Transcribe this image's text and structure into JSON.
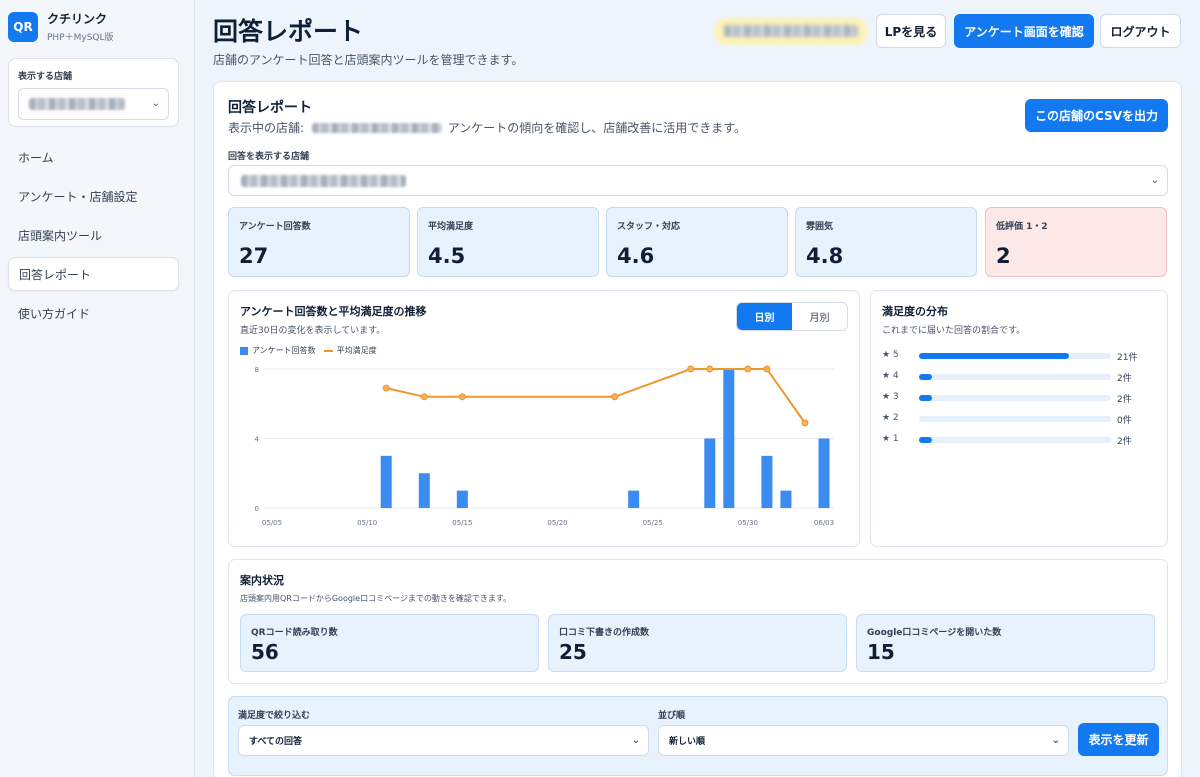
{
  "sidebar": {
    "logo": "QR",
    "app_name": "クチリンク",
    "app_sub": "PHP＋MySQL版",
    "store_label": "表示する店舗",
    "nav": [
      "ホーム",
      "アンケート・店舗設定",
      "店頭案内ツール",
      "回答レポート",
      "使い方ガイド"
    ]
  },
  "header": {
    "title": "回答レポート",
    "description": "店舗のアンケート回答と店頭案内ツールを管理できます。",
    "btn_lp": "LPを見る",
    "btn_survey": "アンケート画面を確認",
    "btn_logout": "ログアウト"
  },
  "report": {
    "title": "回答レポート",
    "subtitle_prefix": "表示中の店舗:",
    "subtitle_suffix": "アンケートの傾向を確認し、店舗改善に活用できます。",
    "csv_button": "この店舗のCSVを出力",
    "store_select_label": "回答を表示する店舗"
  },
  "stats": [
    {
      "label": "アンケート回答数",
      "value": "27"
    },
    {
      "label": "平均満足度",
      "value": "4.5"
    },
    {
      "label": "スタッフ・対応",
      "value": "4.6"
    },
    {
      "label": "雰囲気",
      "value": "4.8"
    },
    {
      "label": "低評価 1・2",
      "value": "2"
    }
  ],
  "trend": {
    "title": "アンケート回答数と平均満足度の推移",
    "sub": "直近30日の変化を表示しています。",
    "toggle_day": "日別",
    "toggle_month": "月別",
    "legend_bar": "アンケート回答数",
    "legend_line": "平均満足度"
  },
  "chart_data": {
    "type": "bar",
    "x": [
      "05/05",
      "05/06",
      "05/07",
      "05/08",
      "05/09",
      "05/10",
      "05/11",
      "05/12",
      "05/13",
      "05/14",
      "05/15",
      "05/16",
      "05/17",
      "05/18",
      "05/19",
      "05/20",
      "05/21",
      "05/22",
      "05/23",
      "05/24",
      "05/25",
      "05/26",
      "05/27",
      "05/28",
      "05/29",
      "05/30",
      "05/31",
      "06/01",
      "06/02",
      "06/03"
    ],
    "tick_labels": [
      "05/05",
      "05/10",
      "05/15",
      "05/20",
      "05/25",
      "05/30",
      "06/03"
    ],
    "ylim": [
      0,
      8
    ],
    "yticks": [
      0,
      4,
      8
    ],
    "grid": true,
    "series": [
      {
        "name": "アンケート回答数",
        "type": "bar",
        "color": "#3b8cf0",
        "values": [
          0,
          0,
          0,
          0,
          0,
          0,
          3,
          0,
          2,
          0,
          1,
          0,
          0,
          0,
          0,
          0,
          0,
          0,
          0,
          1,
          0,
          0,
          0,
          4,
          8,
          0,
          3,
          1,
          0,
          4
        ]
      },
      {
        "name": "平均満足度",
        "type": "line",
        "color": "#f0962c",
        "points": [
          [
            6,
            6.9
          ],
          [
            8,
            6.4
          ],
          [
            10,
            6.4
          ],
          [
            18,
            6.4
          ],
          [
            22,
            8
          ],
          [
            23,
            8
          ],
          [
            25,
            8
          ],
          [
            26,
            8
          ],
          [
            28,
            4.9
          ]
        ]
      }
    ]
  },
  "distribution": {
    "title": "満足度の分布",
    "sub": "これまでに届いた回答の割合です。",
    "rows": [
      {
        "star": "★ 5",
        "count": "21件",
        "ratio": 0.78
      },
      {
        "star": "★ 4",
        "count": "2件",
        "ratio": 0.07
      },
      {
        "star": "★ 3",
        "count": "2件",
        "ratio": 0.07
      },
      {
        "star": "★ 2",
        "count": "0件",
        "ratio": 0
      },
      {
        "star": "★ 1",
        "count": "2件",
        "ratio": 0.07
      }
    ]
  },
  "guide": {
    "title": "案内状況",
    "sub": "店頭案内用QRコードからGoogle口コミページまでの動きを確認できます。",
    "stats": [
      {
        "label": "QRコード読み取り数",
        "value": "56"
      },
      {
        "label": "口コミ下書きの作成数",
        "value": "25"
      },
      {
        "label": "Google口コミページを開いた数",
        "value": "15"
      }
    ]
  },
  "filter": {
    "rating_label": "満足度で絞り込む",
    "rating_value": "すべての回答",
    "sort_label": "並び順",
    "sort_value": "新しい順",
    "update_button": "表示を更新"
  }
}
